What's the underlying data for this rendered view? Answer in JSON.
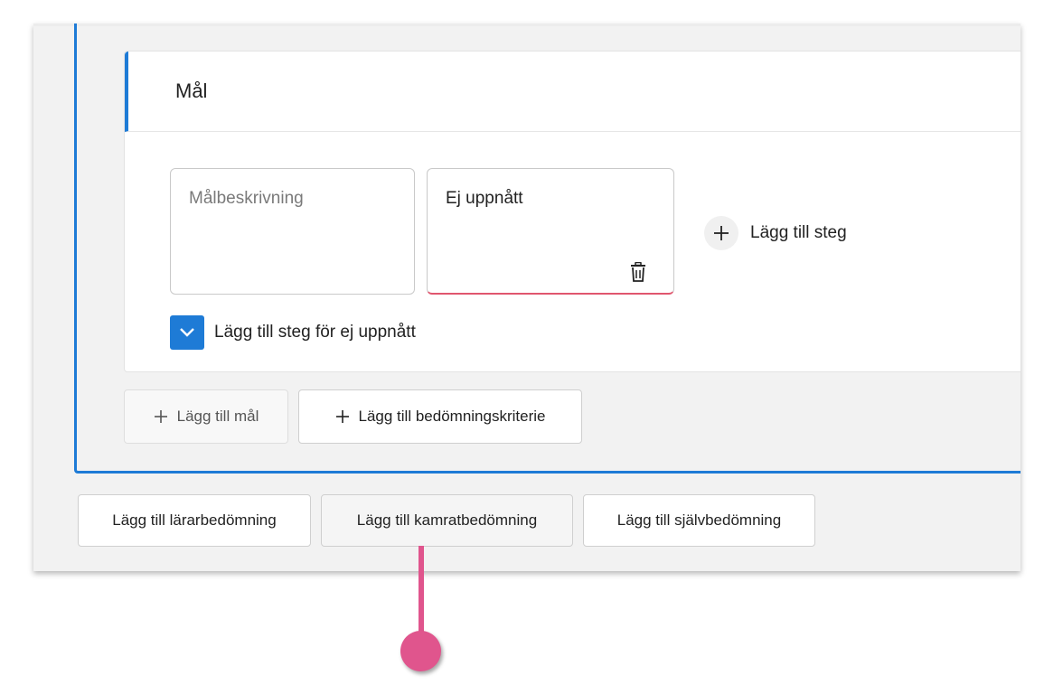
{
  "goal_card": {
    "title": "Mål",
    "description_placeholder": "Målbeskrivning",
    "step_value": "Ej uppnått",
    "add_step_label": "Lägg till steg",
    "checkbox_label": "Lägg till steg för ej uppnått",
    "checkbox_checked": true
  },
  "criteria_actions": {
    "add_goal_label": "Lägg till mål",
    "add_criterion_label": "Lägg till bedömningskriterie"
  },
  "assessment_actions": {
    "teacher_label": "Lägg till lärarbedömning",
    "peer_label": "Lägg till kamratbedömning",
    "self_label": "Lägg till självbedömning"
  },
  "colors": {
    "accent": "#1e7bd6",
    "error_underline": "#e0566e",
    "pointer": "#e0558d"
  },
  "icons": [
    "trash-icon",
    "plus-icon",
    "check-icon"
  ]
}
